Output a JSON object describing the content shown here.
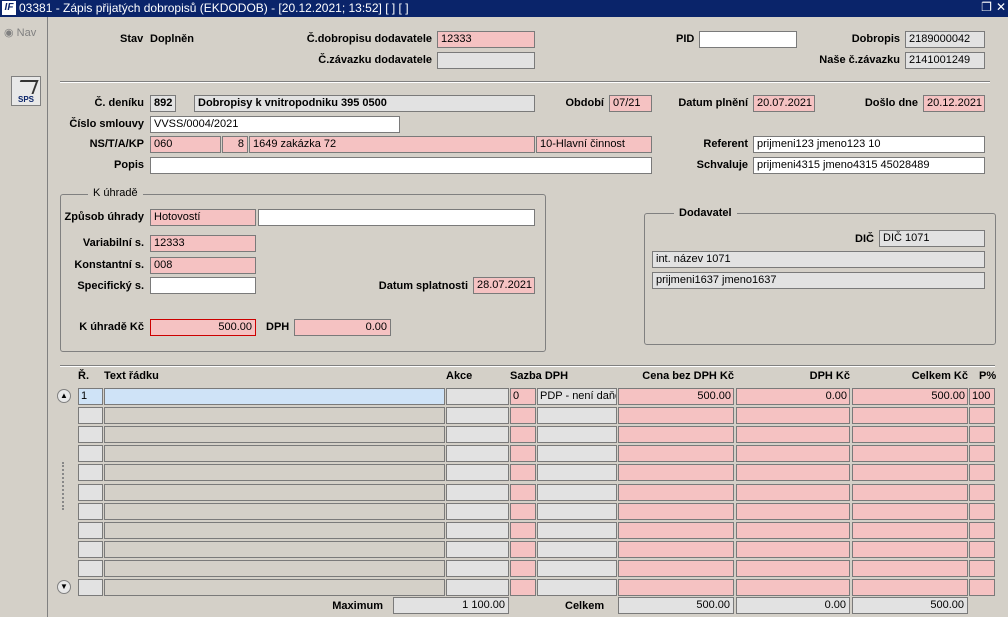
{
  "window": {
    "title": "03381 - Zápis přijatých dobropisů (EKDODOB) - [20.12.2021; 13:52]  [ ] [ ]",
    "app_icon": "IF"
  },
  "nav": {
    "label": "Nav",
    "sps": "SPS"
  },
  "header": {
    "stav_label": "Stav",
    "stav_value": "Doplněn",
    "c_dobropisu_label": "Č.dobropisu dodavatele",
    "c_dobropisu_value": "12333",
    "c_zavazku_label": "Č.závazku dodavatele",
    "c_zavazku_value": "",
    "pid_label": "PID",
    "pid_value": "",
    "dobropis_label": "Dobropis",
    "dobropis_value": "2189000042",
    "nase_zavazku_label": "Naše č.závazku",
    "nase_zavazku_value": "2141001249"
  },
  "doc": {
    "c_deniku_label": "Č. deníku",
    "c_deniku_value": "892",
    "c_deniku_text": "Dobropisy k vnitropodniku 395 0500",
    "obdobi_label": "Období",
    "obdobi_value": "07/21",
    "datum_plneni_label": "Datum plnění",
    "datum_plneni_value": "20.07.2021",
    "doslo_label": "Došlo dne",
    "doslo_value": "20.12.2021",
    "smlouva_label": "Číslo smlouvy",
    "smlouva_value": "VVSS/0004/2021",
    "ns_label": "NS/T/A/KP",
    "ns1": "060",
    "ns2": "8",
    "ns3": "1649 zakázka 72",
    "ns4": "10-Hlavní činnost",
    "popis_label": "Popis",
    "popis_value": "",
    "referent_label": "Referent",
    "referent_value": "prijmeni123 jmeno123 10",
    "schvaluje_label": "Schvaluje",
    "schvaluje_value": "prijmeni4315 jmeno4315 45028489"
  },
  "uhrada": {
    "title": "K úhradě",
    "zpusob_label": "Způsob úhrady",
    "zpusob_value": "Hotovostí",
    "zpusob_extra": "",
    "vs_label": "Variabilní s.",
    "vs_value": "12333",
    "ks_label": "Konstantní s.",
    "ks_value": "008",
    "ss_label": "Specifický s.",
    "ss_value": "",
    "splatnost_label": "Datum splatnosti",
    "splatnost_value": "28.07.2021",
    "kuhrade_label": "K úhradě Kč",
    "kuhrade_value": "500.00",
    "dph_label": "DPH",
    "dph_value": "0.00"
  },
  "dodavatel": {
    "title": "Dodavatel",
    "dic_label": "DIČ",
    "dic_value": "DIČ 1071",
    "nazev": "int. název 1071",
    "osoba": "prijmeni1637 jmeno1637"
  },
  "grid": {
    "headers": {
      "r": "Ř.",
      "text": "Text řádku",
      "akce": "Akce",
      "sazba": "Sazba DPH",
      "cena": "Cena bez DPH Kč",
      "dph": "DPH Kč",
      "celkem": "Celkem Kč",
      "pct": "P%"
    },
    "rows": [
      {
        "r": "1",
        "text": "",
        "akce": "",
        "sazba": "0",
        "sazba_text": "PDP - není daňo",
        "cena": "500.00",
        "dph": "0.00",
        "celkem": "500.00",
        "pct": "100"
      },
      {
        "r": "",
        "text": "",
        "akce": "",
        "sazba": "",
        "sazba_text": "",
        "cena": "",
        "dph": "",
        "celkem": "",
        "pct": ""
      },
      {
        "r": "",
        "text": "",
        "akce": "",
        "sazba": "",
        "sazba_text": "",
        "cena": "",
        "dph": "",
        "celkem": "",
        "pct": ""
      },
      {
        "r": "",
        "text": "",
        "akce": "",
        "sazba": "",
        "sazba_text": "",
        "cena": "",
        "dph": "",
        "celkem": "",
        "pct": ""
      },
      {
        "r": "",
        "text": "",
        "akce": "",
        "sazba": "",
        "sazba_text": "",
        "cena": "",
        "dph": "",
        "celkem": "",
        "pct": ""
      },
      {
        "r": "",
        "text": "",
        "akce": "",
        "sazba": "",
        "sazba_text": "",
        "cena": "",
        "dph": "",
        "celkem": "",
        "pct": ""
      },
      {
        "r": "",
        "text": "",
        "akce": "",
        "sazba": "",
        "sazba_text": "",
        "cena": "",
        "dph": "",
        "celkem": "",
        "pct": ""
      },
      {
        "r": "",
        "text": "",
        "akce": "",
        "sazba": "",
        "sazba_text": "",
        "cena": "",
        "dph": "",
        "celkem": "",
        "pct": ""
      },
      {
        "r": "",
        "text": "",
        "akce": "",
        "sazba": "",
        "sazba_text": "",
        "cena": "",
        "dph": "",
        "celkem": "",
        "pct": ""
      },
      {
        "r": "",
        "text": "",
        "akce": "",
        "sazba": "",
        "sazba_text": "",
        "cena": "",
        "dph": "",
        "celkem": "",
        "pct": ""
      },
      {
        "r": "",
        "text": "",
        "akce": "",
        "sazba": "",
        "sazba_text": "",
        "cena": "",
        "dph": "",
        "celkem": "",
        "pct": ""
      }
    ],
    "footer": {
      "maximum_label": "Maximum",
      "maximum_value": "1 100.00",
      "celkem_label": "Celkem",
      "cena_total": "500.00",
      "dph_total": "0.00",
      "celkem_total": "500.00"
    }
  }
}
